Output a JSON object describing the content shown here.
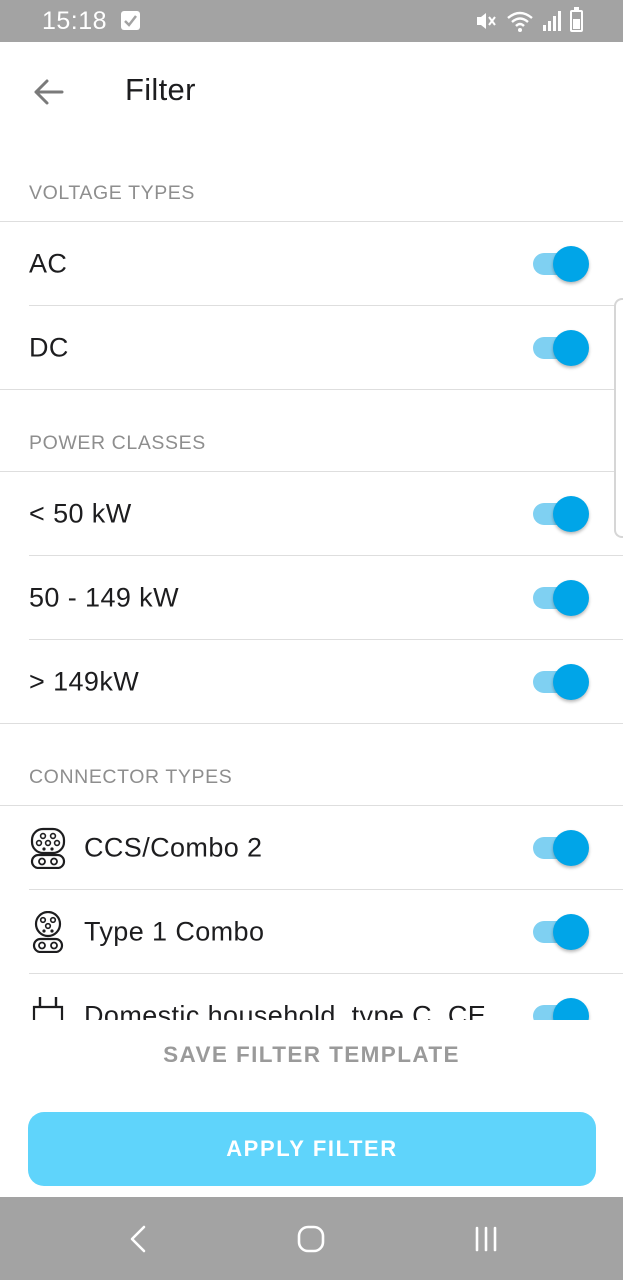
{
  "status_bar": {
    "time": "15:18",
    "icons": [
      "checkbox-icon",
      "mute-icon",
      "wifi-icon",
      "signal-icon",
      "battery-icon"
    ]
  },
  "app_bar": {
    "back_icon": "arrow-left-icon",
    "title": "Filter"
  },
  "sections": {
    "voltage": {
      "header": "VOLTAGE TYPES",
      "items": [
        {
          "label": "AC",
          "enabled": true
        },
        {
          "label": "DC",
          "enabled": true
        }
      ]
    },
    "power": {
      "header": "POWER CLASSES",
      "items": [
        {
          "label": "< 50 kW",
          "enabled": true
        },
        {
          "label": "50 - 149 kW",
          "enabled": true
        },
        {
          "label": "> 149kW",
          "enabled": true
        }
      ]
    },
    "connector": {
      "header": "CONNECTOR TYPES",
      "items": [
        {
          "label": "CCS/Combo 2",
          "icon": "ccs-combo-2-icon",
          "enabled": true
        },
        {
          "label": "Type 1 Combo",
          "icon": "type-1-combo-icon",
          "enabled": true
        },
        {
          "label": "Domestic household, type C, CE",
          "icon": "domestic-plug-icon",
          "enabled": true
        }
      ]
    }
  },
  "footer": {
    "save_label": "SAVE FILTER TEMPLATE",
    "apply_label": "APPLY FILTER"
  },
  "colors": {
    "accent": "#00a5e8",
    "toggle_track": "#7fd0f2",
    "apply_button": "#5fd4fb",
    "system_bars": "#a3a3a3"
  },
  "nav_bar": {
    "icons": [
      "back-nav-icon",
      "home-nav-icon",
      "recents-nav-icon"
    ]
  }
}
